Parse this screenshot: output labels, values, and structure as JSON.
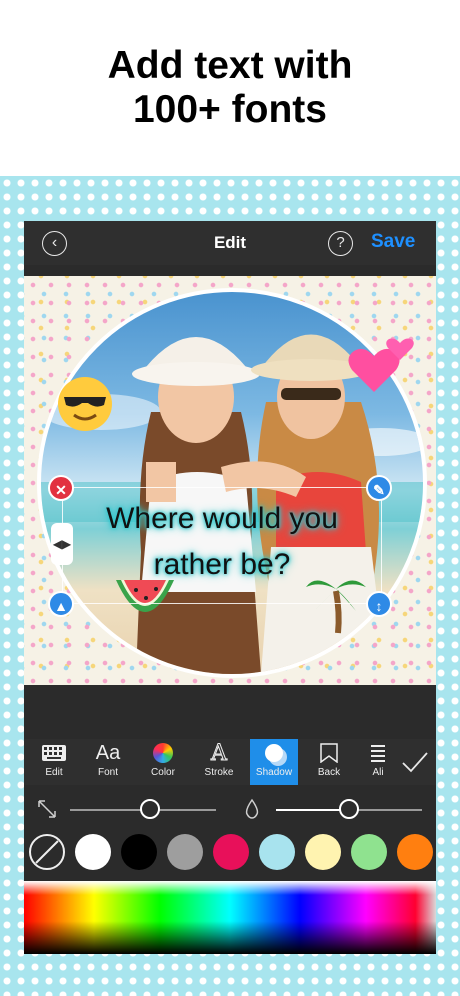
{
  "promo": {
    "headline": "Add text with\n100+ fonts"
  },
  "nav": {
    "title": "Edit",
    "save_label": "Save",
    "back_icon": "chevron-left-circle-icon",
    "help_icon": "?"
  },
  "canvas": {
    "overlay_text": "Where would you\nrather be?",
    "text_shadow_color": "#2fc6cc",
    "stickers": [
      "sunglasses-emoji",
      "two-hearts-emoji",
      "watermelon-emoji",
      "palm-tree-emoji"
    ]
  },
  "toolbar": {
    "items": [
      {
        "label": "Edit",
        "icon": "keyboard-icon"
      },
      {
        "label": "Font",
        "icon": "Aa"
      },
      {
        "label": "Color",
        "icon": "color-wheel-icon"
      },
      {
        "label": "Stroke",
        "icon": "A"
      },
      {
        "label": "Shadow",
        "icon": "shadow-icon",
        "active": true
      },
      {
        "label": "Back",
        "icon": "back-tag-icon"
      },
      {
        "label": "Ali",
        "icon": "align-icon"
      }
    ],
    "done_icon": "checkmark-icon",
    "accent": "#1f8ee9"
  },
  "sliders": {
    "shadow_distance": 0.55,
    "shadow_opacity": 0.5
  },
  "swatches": {
    "colors": [
      "none",
      "#ffffff",
      "#000000",
      "#9e9e9e",
      "#e8105a",
      "#a8e3ee",
      "#fff3b0",
      "#8fe28f",
      "#ff7f10"
    ]
  }
}
